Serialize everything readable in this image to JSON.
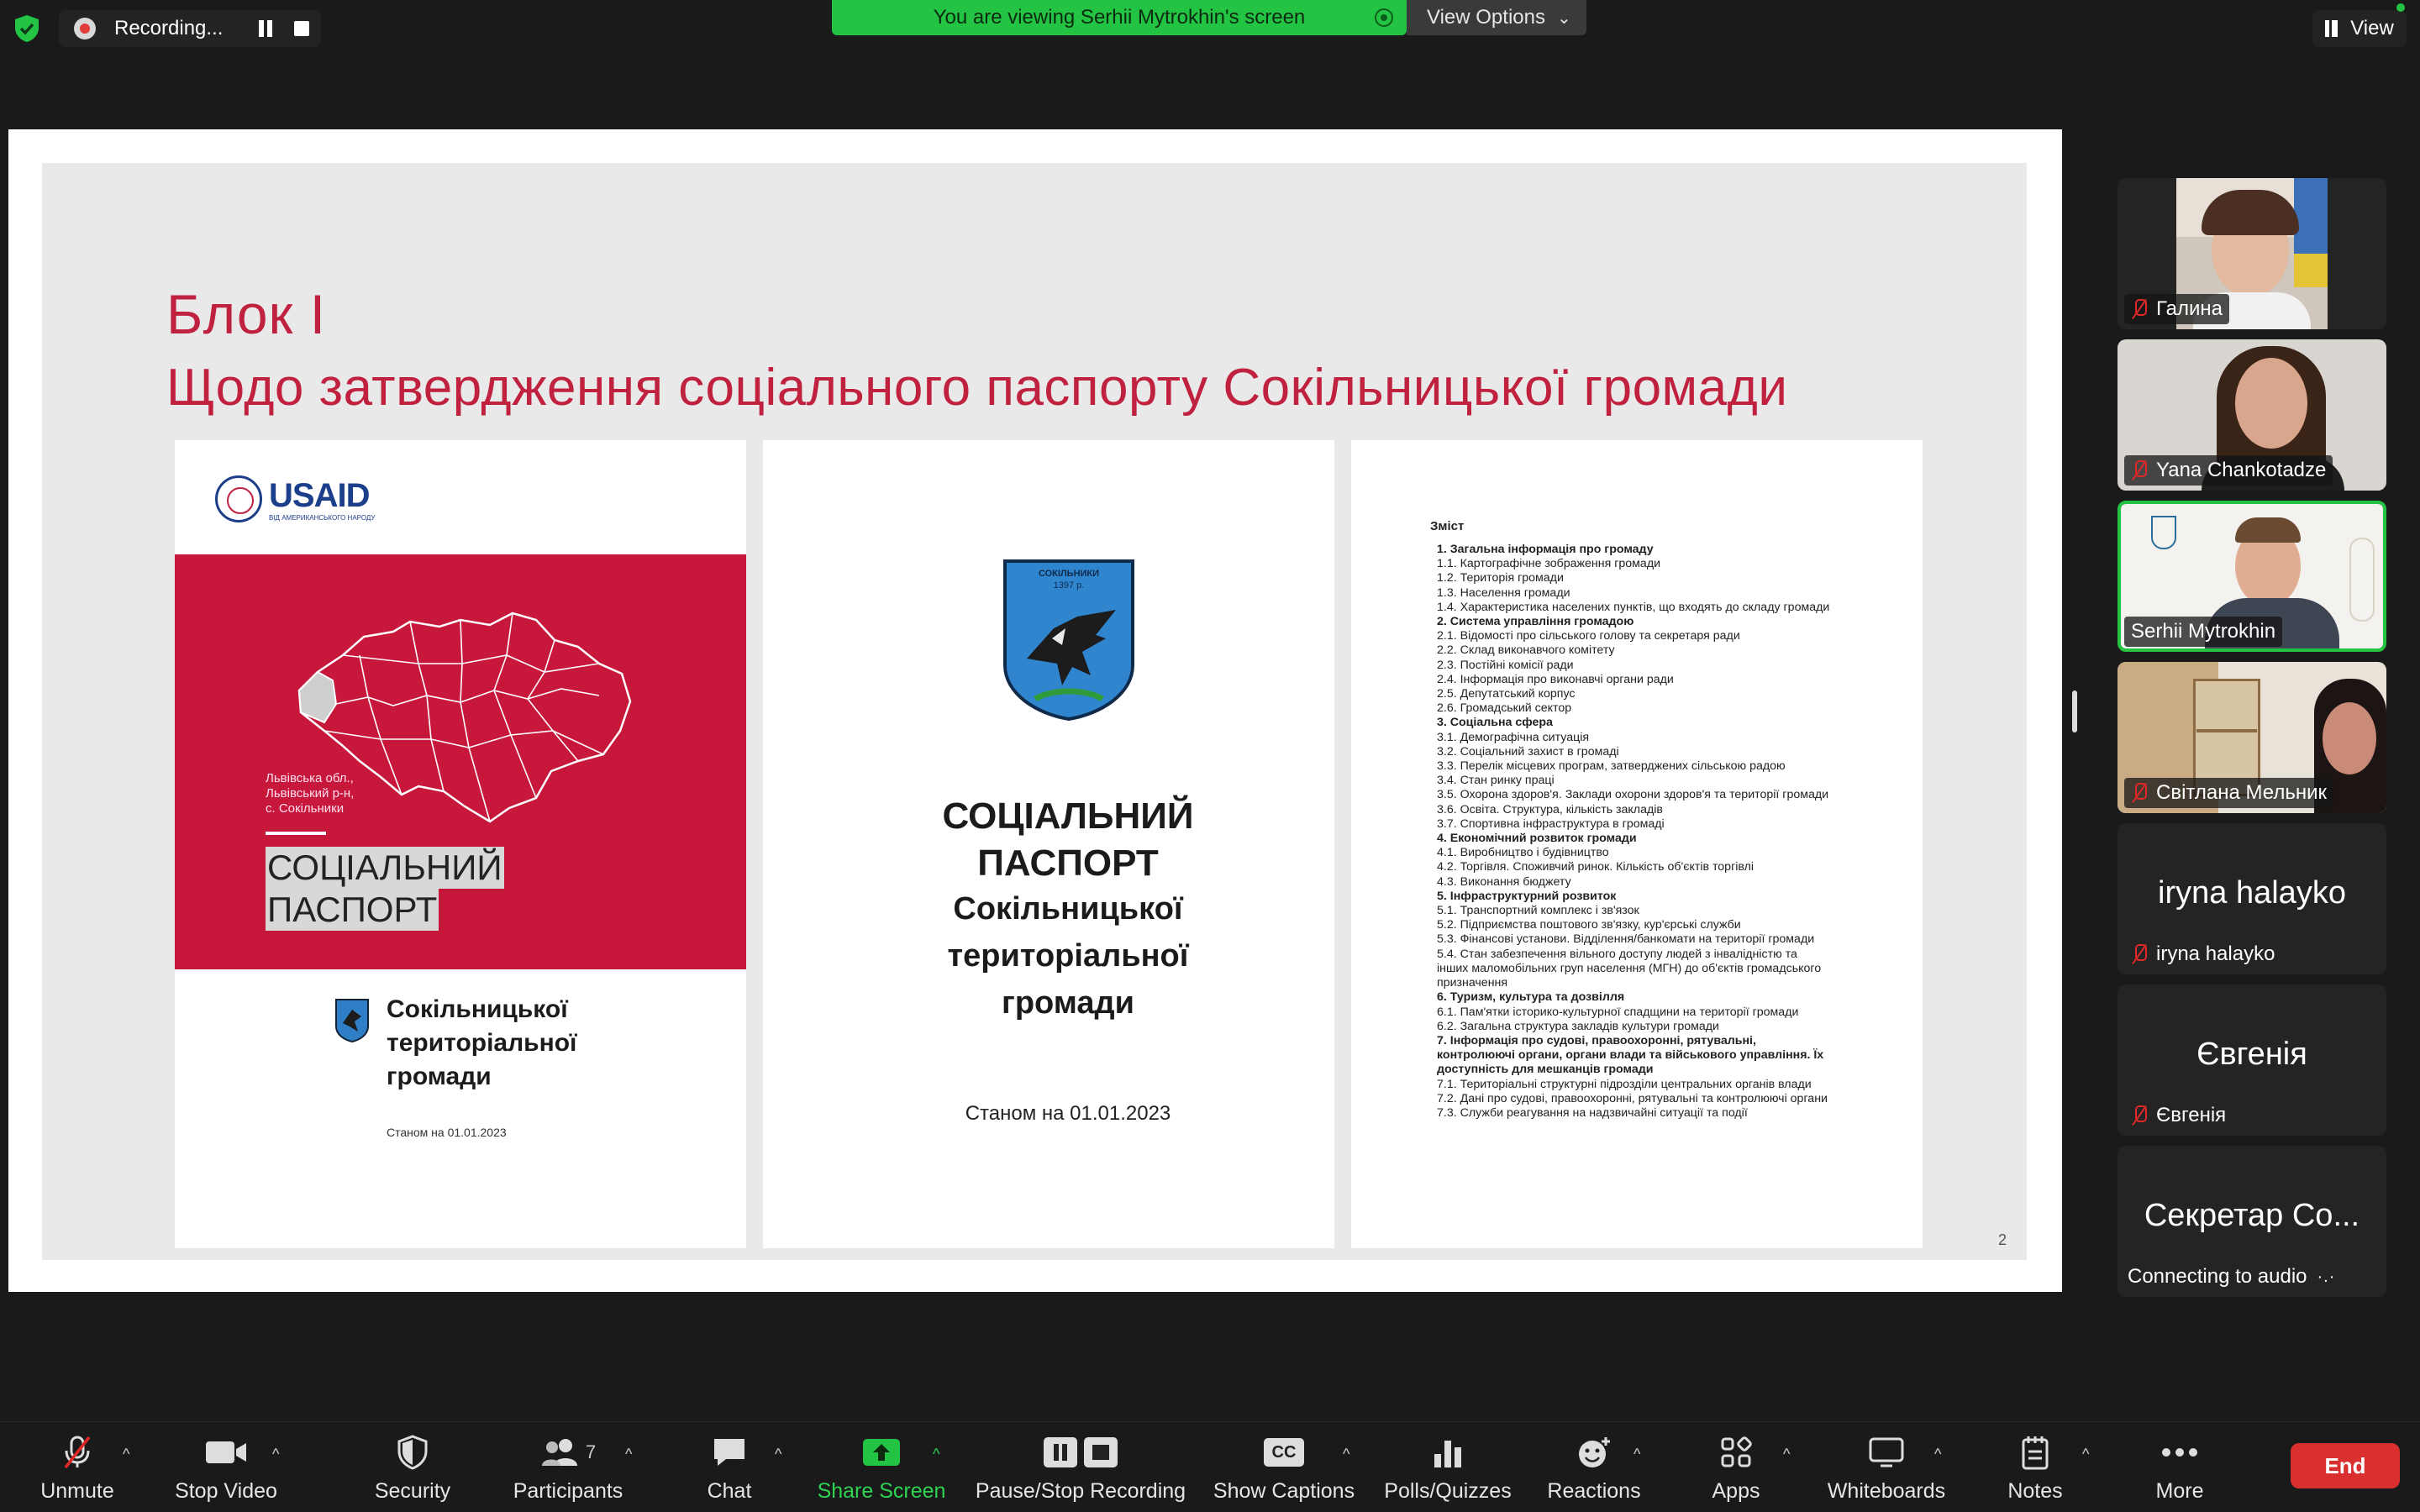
{
  "top_bar": {
    "recording_label": "Recording...",
    "viewing_text": "You are viewing Serhii Mytrokhin's screen",
    "view_options_label": "View Options",
    "view_button_label": "View"
  },
  "slide": {
    "title_line1": "Блок І",
    "title_line2": "Щодо затвердження соціального паспорту Сокільницької громади",
    "page_number": "2",
    "page1": {
      "brand": "USAID",
      "brand_sub": "ВІД АМЕРИКАНСЬКОГО НАРОДУ",
      "location": [
        "Львівська обл.,",
        "Львівський р-н,",
        "с. Сокільники"
      ],
      "title": [
        "СОЦІАЛЬНИЙ",
        "ПАСПОРТ"
      ],
      "subtitle": [
        "Сокільницької",
        "територіальної",
        "громади"
      ],
      "date": "Станом на 01.01.2023"
    },
    "page2": {
      "coa_text": "СОКІЛЬНИКИ\n1397 р.",
      "title": [
        "СОЦІАЛЬНИЙ",
        "ПАСПОРТ"
      ],
      "subtitle": [
        "Сокільницької",
        "територіальної",
        "громади"
      ],
      "date": "Станом на 01.01.2023"
    },
    "page3": {
      "heading": "Зміст",
      "items": [
        {
          "t": "1. Загальна інформація про громаду",
          "b": true
        },
        {
          "t": "1.1. Картографічне зображення громади"
        },
        {
          "t": "1.2. Територія громади"
        },
        {
          "t": "1.3. Населення громади"
        },
        {
          "t": "1.4. Характеристика населених пунктів, що входять до складу громади"
        },
        {
          "t": "2. Система управління громадою",
          "b": true
        },
        {
          "t": "2.1. Відомості про сільського голову та секретаря ради"
        },
        {
          "t": "2.2. Склад виконавчого комітету"
        },
        {
          "t": "2.3. Постійні комісії ради"
        },
        {
          "t": "2.4. Інформація про виконавчі органи ради"
        },
        {
          "t": "2.5. Депутатський корпус"
        },
        {
          "t": "2.6. Громадський сектор"
        },
        {
          "t": "3. Соціальна сфера",
          "b": true
        },
        {
          "t": "3.1. Демографічна ситуація"
        },
        {
          "t": "3.2. Соціальний захист в громаді"
        },
        {
          "t": "3.3. Перелік місцевих програм, затверджених сільською радою"
        },
        {
          "t": "3.4. Стан ринку праці"
        },
        {
          "t": "3.5. Охорона здоров'я. Заклади охорони здоров'я та території громади"
        },
        {
          "t": "3.6. Освіта. Структура, кількість закладів"
        },
        {
          "t": "3.7. Спортивна інфраструктура в громаді"
        },
        {
          "t": "4. Економічний розвиток громади",
          "b": true
        },
        {
          "t": "4.1. Виробництво і будівництво"
        },
        {
          "t": "4.2. Торгівля. Споживчий ринок. Кількість об'єктів торгівлі"
        },
        {
          "t": "4.3. Виконання бюджету"
        },
        {
          "t": "5. Інфраструктурний розвиток",
          "b": true
        },
        {
          "t": "5.1. Транспортний комплекс і зв'язок"
        },
        {
          "t": "5.2. Підприємства поштового зв'язку, кур'єрські служби"
        },
        {
          "t": "5.3. Фінансові установи. Відділення/банкомати на території громади"
        },
        {
          "t": "5.4. Стан забезпечення вільного доступу людей з інвалідністю та інших маломобільних груп населення (МГН) до об'єктів громадського призначення"
        },
        {
          "t": "6. Туризм, культура та дозвілля",
          "b": true
        },
        {
          "t": "6.1. Пам'ятки історико-культурної спадщини на території громади"
        },
        {
          "t": "6.2. Загальна структура закладів культури громади"
        },
        {
          "t": "7. Інформація про судові, правоохоронні, рятувальні, контролюючі органи, органи влади та військового управління. Їх доступність для мешканців громади",
          "b": true
        },
        {
          "t": "7.1. Територіальні структурні підрозділи центральних органів влади"
        },
        {
          "t": "7.2. Дані про судові, правоохоронні, рятувальні та контролюючі органи"
        },
        {
          "t": "7.3. Служби реагування на надзвичайні ситуації та події"
        }
      ]
    }
  },
  "participants": [
    {
      "name": "Галина",
      "muted": true,
      "video": true
    },
    {
      "name": "Yana Chankotadze",
      "muted": true,
      "video": true
    },
    {
      "name": "Serhii Mytrokhin",
      "muted": false,
      "video": true,
      "active": true
    },
    {
      "name": "Світлана Мельник",
      "muted": true,
      "video": true
    },
    {
      "name": "iryna halayko",
      "display_name": "iryna halayko",
      "muted": true,
      "video": false
    },
    {
      "name": "Євгенія",
      "display_name": "Євгенія",
      "muted": true,
      "video": false
    },
    {
      "display_name": "Секретар Со...",
      "status": "Connecting to audio",
      "video": false
    }
  ],
  "toolbar": {
    "unmute": "Unmute",
    "stop_video": "Stop Video",
    "security": "Security",
    "participants": "Participants",
    "participants_count": "7",
    "chat": "Chat",
    "share_screen": "Share Screen",
    "pause_stop_recording": "Pause/Stop Recording",
    "show_captions": "Show Captions",
    "cc_label": "CC",
    "polls": "Polls/Quizzes",
    "reactions": "Reactions",
    "apps": "Apps",
    "whiteboards": "Whiteboards",
    "notes": "Notes",
    "more": "More",
    "end": "End"
  },
  "colors": {
    "accent_green": "#23c343",
    "slide_red": "#c0213f",
    "end_red": "#d9302f"
  }
}
